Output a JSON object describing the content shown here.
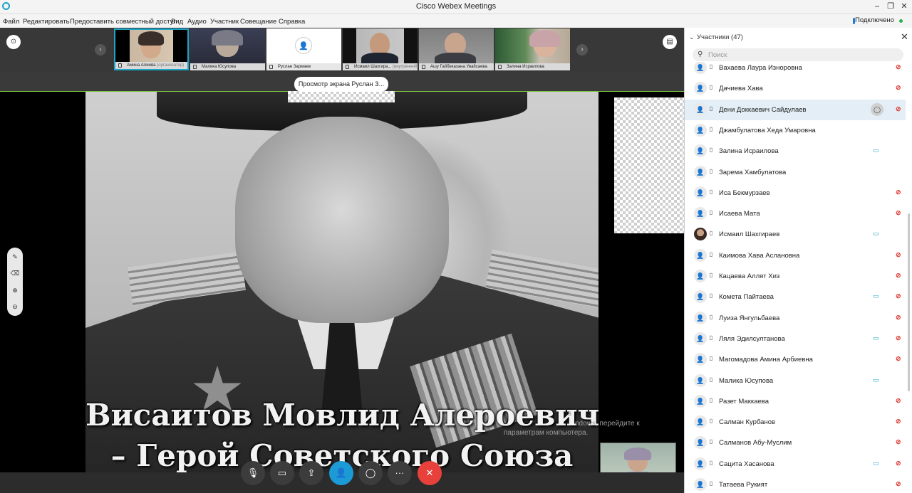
{
  "window": {
    "title": "Cisco Webex Meetings",
    "status": "Подключено"
  },
  "menu": [
    "Файл",
    "Редактировать",
    "Предоставить совместный доступ",
    "Вид",
    "Аудио",
    "Участник",
    "Совещание",
    "Справка"
  ],
  "filmstrip": [
    {
      "name": "Амина Алиева",
      "role": "(организатор)"
    },
    {
      "name": "Малика Юсупова"
    },
    {
      "name": "Руслан Зармаев"
    },
    {
      "name": "Исмаил Шахгира...",
      "role": "(внутренний)"
    },
    {
      "name": "Ашу Гайбекахана Увайсаева"
    },
    {
      "name": "Залина Исраилова"
    }
  ],
  "share": {
    "tooltip": "Просмотр экрана Руслан З...",
    "line1": "Висаитов Мовлид Алероевич",
    "line2": "– Герой Советского Союза",
    "watermark_a": "s",
    "watermark_b": "ndows, перейдите к",
    "watermark_c": "параметрам компьютера."
  },
  "panel": {
    "title": "Участники (47)",
    "search_placeholder": "Поиск",
    "participants": [
      {
        "name": "Вахаева Лаура Изноровна",
        "mic": "muted"
      },
      {
        "name": "Дачиева Хава",
        "mic": "muted"
      },
      {
        "name": "Дени Доккаевич Сайдулаев",
        "mic": "muted",
        "selected": true,
        "chat": true
      },
      {
        "name": "Джамбулатова Хеда Умаровна"
      },
      {
        "name": "Залина Исраилова",
        "video": true
      },
      {
        "name": "Зарема Хамбулатова"
      },
      {
        "name": "Иса Бекмурзаев",
        "mic": "muted"
      },
      {
        "name": "Исаева Мата",
        "mic": "muted"
      },
      {
        "name": "Исмаил Шахгираев",
        "video": true,
        "photo": true
      },
      {
        "name": "Каимова Хава Аслановна",
        "mic": "muted"
      },
      {
        "name": "Кацаева Аллят Хиз",
        "mic": "muted"
      },
      {
        "name": "Комета Пайтаева",
        "video": true,
        "mic": "muted"
      },
      {
        "name": "Луиза Янгульбаева",
        "mic": "muted"
      },
      {
        "name": "Ляля Эдилсултанова",
        "video": true,
        "mic": "muted"
      },
      {
        "name": "Магомадова Амина Арбиевна",
        "mic": "muted"
      },
      {
        "name": "Малика Юсупова",
        "video": true
      },
      {
        "name": "Разет Маккаева",
        "mic": "muted"
      },
      {
        "name": "Салман Курбанов",
        "mic": "muted"
      },
      {
        "name": "Салманов Абу-Муслим",
        "mic": "muted"
      },
      {
        "name": "Сацита Хасанова",
        "video": true,
        "mic": "muted"
      },
      {
        "name": "Татаева Рукият",
        "mic": "muted"
      }
    ]
  },
  "colors": {
    "accent": "#1ca3c6",
    "muted": "#e0342f",
    "share_border": "#7ec63e",
    "end": "#e8413b",
    "participants_btn": "#1c9ad6"
  }
}
